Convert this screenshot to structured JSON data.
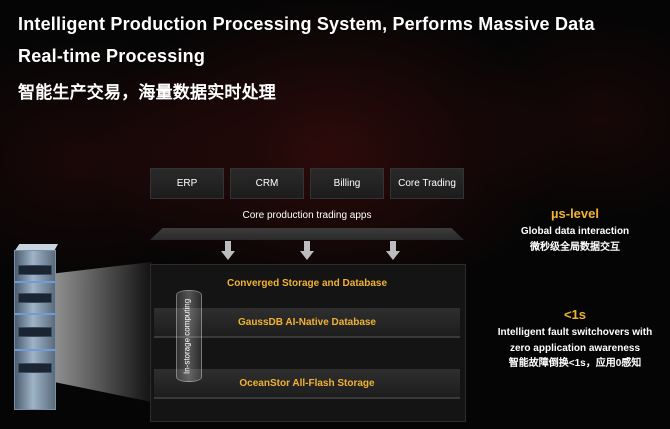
{
  "header": {
    "title_line1": "Intelligent Production Processing System, Performs Massive Data",
    "title_line2": "Real-time Processing",
    "title_cn": "智能生产交易，海量数据实时处理"
  },
  "apps": {
    "items": [
      "ERP",
      "CRM",
      "Billing",
      "Core Trading"
    ],
    "label": "Core production trading apps"
  },
  "storage": {
    "converged_label": "Converged Storage and Database",
    "database_layer": "GaussDB AI-Native Database",
    "flash_layer": "OceanStor All-Flash Storage",
    "in_storage_label": "In-storage computing"
  },
  "stats": {
    "latency": {
      "value": "µs-level",
      "line1": "Global data interaction",
      "line2": "微秒级全局数据交互"
    },
    "switchover": {
      "value": "<1s",
      "line1": "Intelligent fault switchovers with",
      "line2": "zero application awareness",
      "line3": "智能故障倒换<1s，应用0感知"
    }
  },
  "colors": {
    "accent": "#f2b234",
    "background": "#050505"
  }
}
